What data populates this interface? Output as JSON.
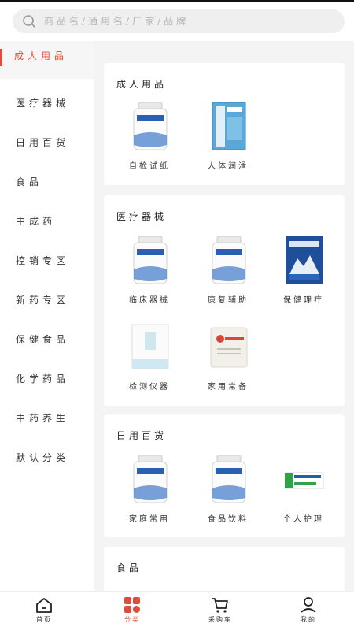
{
  "search": {
    "placeholder": "商品名/通用名/厂家/品牌"
  },
  "sidebar": {
    "items": [
      {
        "label": "成人用品"
      },
      {
        "label": "医疗器械"
      },
      {
        "label": "日用百货"
      },
      {
        "label": "食品"
      },
      {
        "label": "中成药"
      },
      {
        "label": "控销专区"
      },
      {
        "label": "新药专区"
      },
      {
        "label": "保健食品"
      },
      {
        "label": "化学药品"
      },
      {
        "label": "中药养生"
      },
      {
        "label": "默认分类"
      }
    ]
  },
  "sections": [
    {
      "title": "成人用品",
      "products": [
        {
          "name": "自检试纸"
        },
        {
          "name": "人体润滑"
        }
      ]
    },
    {
      "title": "医疗器械",
      "products": [
        {
          "name": "临床器械"
        },
        {
          "name": "康复辅助"
        },
        {
          "name": "保健理疗"
        },
        {
          "name": "检测仪器"
        },
        {
          "name": "家用常备"
        }
      ]
    },
    {
      "title": "日用百货",
      "products": [
        {
          "name": "家庭常用"
        },
        {
          "name": "食品饮料"
        },
        {
          "name": "个人护理"
        }
      ]
    },
    {
      "title": "食品",
      "products": []
    }
  ],
  "tabs": [
    {
      "label": "首页"
    },
    {
      "label": "分类"
    },
    {
      "label": "采购车"
    },
    {
      "label": "我的"
    }
  ],
  "colors": {
    "accent": "#e24a3b",
    "bottle_label": "#2c5fb4"
  }
}
